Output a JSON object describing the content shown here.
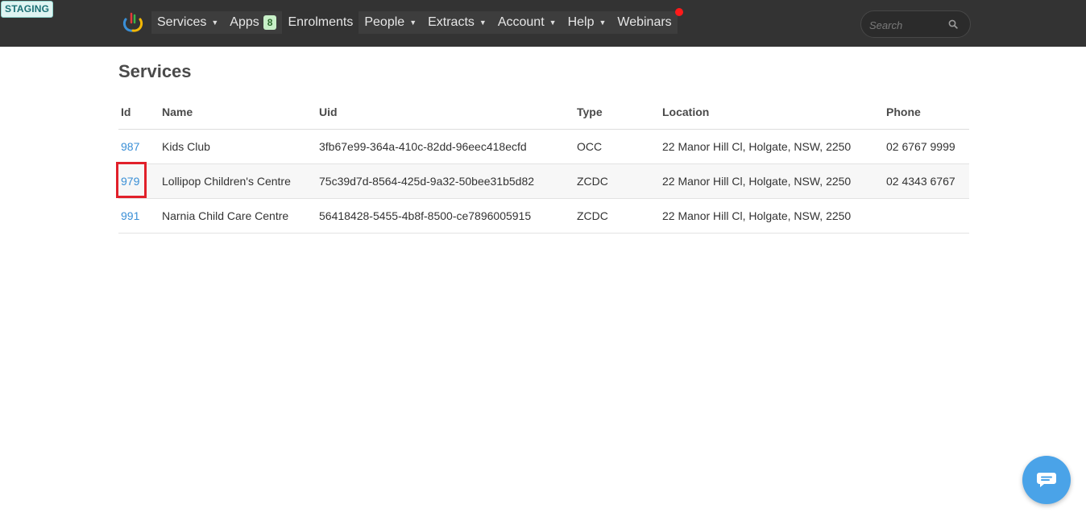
{
  "env_badge": "STAGING",
  "nav": {
    "services_label": "Services",
    "apps_label": "Apps",
    "apps_count": "8",
    "enrolments_label": "Enrolments",
    "people_label": "People",
    "extracts_label": "Extracts",
    "account_label": "Account",
    "help_label": "Help",
    "webinars_label": "Webinars"
  },
  "search": {
    "placeholder": "Search"
  },
  "page": {
    "title": "Services"
  },
  "table": {
    "headers": {
      "id": "Id",
      "name": "Name",
      "uid": "Uid",
      "type": "Type",
      "location": "Location",
      "phone": "Phone"
    },
    "rows": [
      {
        "id": "987",
        "name": "Kids Club",
        "uid": "3fb67e99-364a-410c-82dd-96eec418ecfd",
        "type": "OCC",
        "location": "22 Manor Hill Cl, Holgate, NSW, 2250",
        "phone": "02 6767 9999"
      },
      {
        "id": "979",
        "name": "Lollipop Children's Centre",
        "uid": "75c39d7d-8564-425d-9a32-50bee31b5d82",
        "type": "ZCDC",
        "location": "22 Manor Hill Cl, Holgate, NSW, 2250",
        "phone": "02 4343 6767"
      },
      {
        "id": "991",
        "name": "Narnia Child Care Centre",
        "uid": "56418428-5455-4b8f-8500-ce7896005915",
        "type": "ZCDC",
        "location": "22 Manor Hill Cl, Holgate, NSW, 2250",
        "phone": ""
      }
    ]
  },
  "colors": {
    "topbar": "#333333",
    "link": "#3a8fd6",
    "highlight": "#e1202a",
    "notification": "#ff1a1a",
    "chat_button": "#4aa3e8",
    "apps_badge": "#c8f0c8"
  },
  "icons": {
    "logo": "brand-logo-icon",
    "search": "search-icon",
    "chat": "chat-bubble-icon",
    "dropdown": "caret-down-icon"
  }
}
